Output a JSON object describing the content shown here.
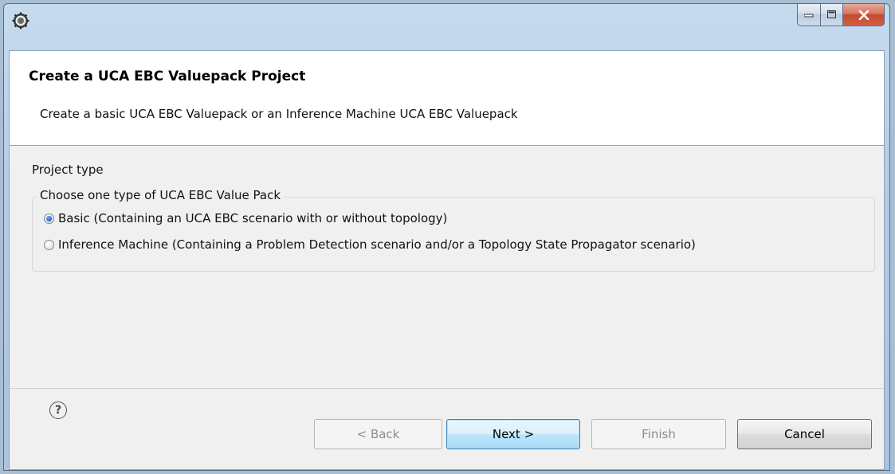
{
  "window": {
    "controls": {
      "minimize": "minimize-icon",
      "maximize": "maximize-icon",
      "close": "close-icon"
    }
  },
  "banner": {
    "title": "Create a UCA EBC Valuepack Project",
    "description": "Create a basic UCA EBC Valuepack or an Inference Machine UCA EBC Valuepack"
  },
  "project_type": {
    "label": "Project type",
    "group_label": "Choose one type of UCA EBC Value Pack",
    "options": [
      {
        "label": "Basic (Containing an UCA EBC scenario with or without topology)",
        "selected": true
      },
      {
        "label": "Inference Machine (Containing a Problem Detection scenario and/or a Topology State Propagator scenario)",
        "selected": false
      }
    ]
  },
  "footer": {
    "help_icon": "help-icon",
    "help_glyph": "?",
    "buttons": {
      "back": "< Back",
      "next": "Next >",
      "finish": "Finish",
      "cancel": "Cancel"
    }
  },
  "colors": {
    "accent": "#3c7fb1",
    "close": "#c6492f",
    "disabled_text": "#8d8d8d"
  }
}
